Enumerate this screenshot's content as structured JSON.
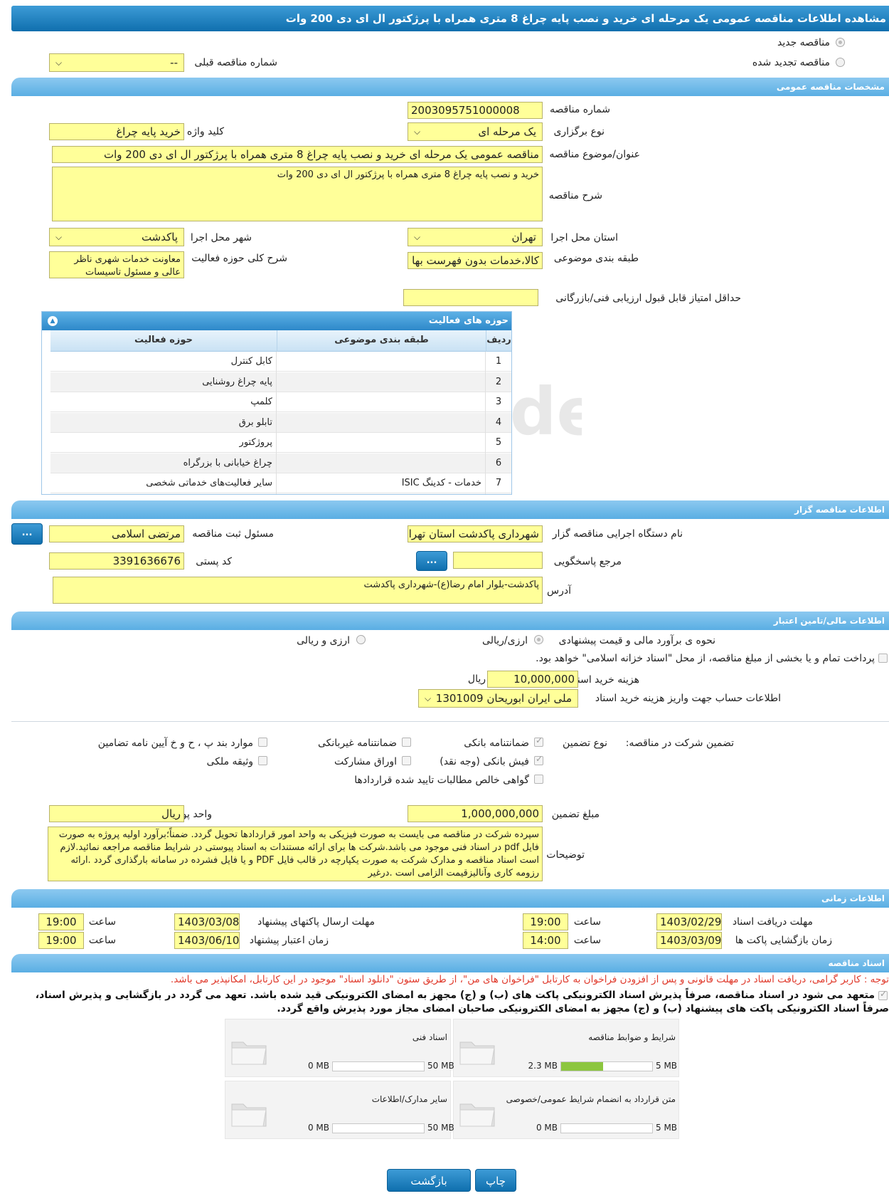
{
  "header": {
    "title": "مشاهده اطلاعات مناقصه عمومی یک مرحله ای خرید و نصب پایه چراغ 8 متری همراه با پرژکتور ال ای دی 200 وات"
  },
  "top_options": {
    "new_tender": "مناقصه جدید",
    "renewed_tender": "مناقصه تجدید شده",
    "prev_number_label": "شماره مناقصه قبلی",
    "prev_number_value": "--"
  },
  "general": {
    "section_title": "مشخصات مناقصه عمومی",
    "number_label": "شماره مناقصه",
    "number_value": "2003095751000008",
    "holding_type_label": "نوع برگزاری",
    "holding_type_value": "یک مرحله ای",
    "keyword_label": "کلید واژه",
    "keyword_value": "خرید پایه چراغ",
    "subject_label": "عنوان/موضوع مناقصه",
    "subject_value": "مناقصه عمومی یک مرحله ای خرید و نصب پایه چراغ 8 متری همراه با پرژکتور ال ای دی 200 وات",
    "description_label": "شرح مناقصه",
    "description_value": "خرید و نصب پایه چراغ 8 متری همراه با پرژکتور ال ای دی 200 وات",
    "province_label": "استان محل اجرا",
    "province_value": "تهران",
    "city_label": "شهر محل اجرا",
    "city_value": "پاکدشت",
    "category_label": "طبقه بندی موضوعی",
    "category_value": "کالا،خدمات بدون فهرست بها",
    "activity_desc_label": "شرح کلی حوزه فعالیت",
    "activity_desc_value": "معاونت خدمات شهری ناظر عالی و مسئول تاسیسات",
    "min_score_label": "حداقل امتیاز قابل قبول ارزیابی فنی/بازرگانی",
    "min_score_value": ""
  },
  "activities": {
    "title": "حوزه های فعالیت",
    "col_row": "ردیف",
    "col_category": "طبقه بندی موضوعی",
    "col_activity": "حوزه فعالیت",
    "rows": [
      {
        "n": "1",
        "category": "",
        "activity": "کابل کنترل"
      },
      {
        "n": "2",
        "category": "",
        "activity": "پایه چراغ روشنایی"
      },
      {
        "n": "3",
        "category": "",
        "activity": "کلمپ"
      },
      {
        "n": "4",
        "category": "",
        "activity": "تابلو برق"
      },
      {
        "n": "5",
        "category": "",
        "activity": "پروژکتور"
      },
      {
        "n": "6",
        "category": "",
        "activity": "چراغ خیابانی با بزرگراه"
      },
      {
        "n": "7",
        "category": "خدمات - کدینگ ISIC",
        "activity": "سایر فعالیت‌های خدماتی شخصی"
      }
    ]
  },
  "organizer": {
    "section_title": "اطلاعات مناقصه گزار",
    "org_name_label": "نام دستگاه اجرایی مناقصه گزار",
    "org_name_value": "شهرداری پاکدشت استان تهران",
    "registrar_label": "مسئول ثبت مناقصه",
    "registrar_value": "مرتضی اسلامی",
    "reference_label": "مرجع پاسخگویی",
    "reference_value": "",
    "postal_label": "کد پستی",
    "postal_value": "3391636676",
    "address_label": "آدرس",
    "address_value": "پاکدشت-بلوار امام رضا(ع)-شهرداری پاکدشت",
    "dots": "..."
  },
  "finance": {
    "section_title": "اطلاعات مالی/تامین اعتبار",
    "estimate_label": "نحوه ی برآورد مالی و قیمت پیشنهادی",
    "opt_rial": "ارزی/ریالی",
    "opt_fx_rial": "ارزی و ریالی",
    "treasury_text": "پرداخت تمام و یا بخشی از مبلغ مناقصه، از محل \"اسناد خزانه اسلامی\" خواهد بود.",
    "doc_cost_label": "هزینه خرید اسناد",
    "doc_cost_value": "10,000,000",
    "doc_cost_unit": "ریال",
    "account_label": "اطلاعات حساب جهت واریز هزینه خرید اسناد",
    "account_value": "ملی ایران ابوریحان 1301009"
  },
  "guarantee": {
    "title": "تضمین شرکت در مناقصه:",
    "type_label": "نوع تضمین",
    "bank_guarantee": "ضمانتنامه بانکی",
    "nonbank_guarantee": "ضمانتنامه غیربانکی",
    "clauses": "موارد بند پ ، ح و خ آیین نامه تضامین",
    "bank_receipt": "فیش بانکی (وجه نقد)",
    "bonds": "اوراق مشارکت",
    "property": "وثیقه ملکی",
    "net_claims": "گواهی خالص مطالبات تایید شده قراردادها",
    "amount_label": "مبلغ تضمین",
    "amount_value": "1,000,000,000",
    "currency_label": "واحد پول",
    "currency_value": "ریال",
    "notes_label": "توضیحات",
    "notes_value": "سپرده شرکت در مناقصه می بایست به صورت فیزیکی به واحد امور قراردادها تحویل گردد. ضمناً؛برآورد اولیه پروژه به صورت فایل pdf در اسناد فنی موجود می باشد.شرکت ها برای ارائه مستندات به اسناد پیوستی در شرایط مناقصه مراجعه نمائید.لازم است اسناد مناقصه و مدارک شرکت به صورت یکپارچه در قالب فایل PDF و یا فایل فشرده در سامانه بارگذاری گردد .ارائه رزومه کاری وآنالیزقیمت الزامی است .درغیر"
  },
  "timing": {
    "section_title": "اطلاعات زمانی",
    "receive_label": "مهلت دریافت اسناد",
    "receive_date": "1403/02/29",
    "receive_time": "19:00",
    "send_label": "مهلت ارسال پاکتهای پیشنهاد",
    "send_date": "1403/03/08",
    "send_time": "19:00",
    "open_label": "زمان بازگشایی پاکت ها",
    "open_date": "1403/03/09",
    "open_time": "14:00",
    "validity_label": "زمان اعتبار پیشنهاد",
    "validity_date": "1403/06/10",
    "validity_time": "19:00",
    "time_label": "ساعت"
  },
  "documents": {
    "section_title": "اسناد مناقصه",
    "notice": "توجه : کاربر گرامی، دریافت اسناد در مهلت قانونی و پس از افزودن فراخوان به کارتابل \"فراخوان های من\"، از طریق ستون \"دانلود اسناد\" موجود در این کارتابل، امکانپذیر می باشد.",
    "commit_line1": "متعهد می شود در اسناد مناقصه، صرفاً پذیرش اسناد الکترونیکی پاکت های (ب) و (ج) مجهز به امضای الکترونیکی قید شده باشد. تعهد می گردد در بازگشایی و پذیرش اسناد،",
    "commit_line2": "صرفاً اسناد الکترونیکی پاکت های پیشنهاد (ب) و (ج) مجهز به امضای الکترونیکی صاحبان امضای مجاز مورد پذیرش واقع گردد.",
    "items": [
      {
        "name": "شرایط و ضوابط مناقصه",
        "used": "2.3 MB",
        "max": "5 MB",
        "fill": 0.46
      },
      {
        "name": "اسناد فنی",
        "used": "0 MB",
        "max": "50 MB",
        "fill": 0
      },
      {
        "name": "متن قرارداد به انضمام شرایط عمومی/خصوصی",
        "used": "0 MB",
        "max": "5 MB",
        "fill": 0
      },
      {
        "name": "سایر مدارک/اطلاعات",
        "used": "0 MB",
        "max": "50 MB",
        "fill": 0
      }
    ]
  },
  "actions": {
    "print": "چاپ",
    "back": "بازگشت"
  },
  "colors": {
    "header_blue": "#0f6fae",
    "section_blue": "#5aaee3",
    "field_yellow": "#ffff99",
    "progress_green": "#8cc63f",
    "notice_red": "#e03a2c"
  }
}
